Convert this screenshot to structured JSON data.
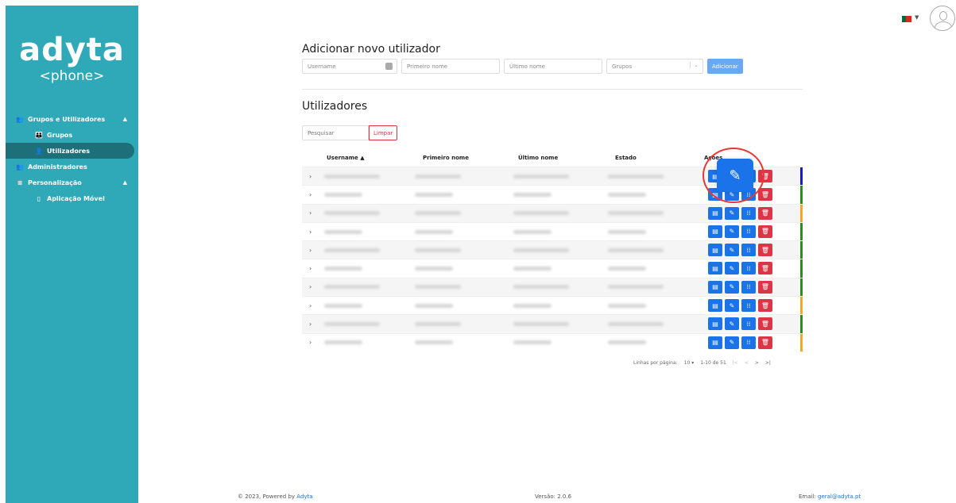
{
  "brand": {
    "name": "adyta",
    "sub": "<phone>"
  },
  "sidebar": {
    "items": [
      {
        "label": "Grupos e Utilizadores",
        "icon": "users-icon",
        "glyph": "👥",
        "caret": "▲"
      },
      {
        "label": "Grupos",
        "icon": "group-icon",
        "glyph": "👪"
      },
      {
        "label": "Utilizadores",
        "icon": "user-icon",
        "glyph": "👤"
      },
      {
        "label": "Administradores",
        "icon": "admin-icon",
        "glyph": "👥"
      },
      {
        "label": "Personalização",
        "icon": "menu-icon",
        "glyph": "≡",
        "caret": "▲"
      },
      {
        "label": "Aplicação Móvel",
        "icon": "mobile-icon",
        "glyph": "▯"
      }
    ]
  },
  "add_user": {
    "title": "Adicionar novo utilizador",
    "username_placeholder": "Username",
    "first_name_placeholder": "Primeiro nome",
    "last_name_placeholder": "Último nome",
    "groups_placeholder": "Grupos",
    "add_label": "Adicionar"
  },
  "users": {
    "title": "Utilizadores",
    "search_placeholder": "Pesquisar",
    "clear_label": "Limpar",
    "columns": [
      "Username ▲",
      "Primeiro nome",
      "Último nome",
      "Estado",
      "Ações"
    ],
    "rows": 10,
    "status_colors": [
      "#1a1acc",
      "#2e8b1f",
      "#f5a623",
      "#2e8b1f",
      "#2e8b1f",
      "#2e8b1f",
      "#2e8b1f",
      "#f5a623",
      "#2e8b1f",
      "#f5a623"
    ],
    "row_action_glyphs": [
      "▤",
      "✎",
      "⁞⁞",
      "🗑"
    ]
  },
  "pager": {
    "rows_label": "Linhas por página:",
    "rows_value": "10",
    "range": "1-10 de 51",
    "first": "|<",
    "prev": "<",
    "next": ">",
    "last": ">|"
  },
  "zoom_edit_glyph": "✎",
  "footer": {
    "copyright": "© 2023, Powered by ",
    "powered_link": "Adyta",
    "version": "Versão: 2.0.6",
    "email_label": "Email: ",
    "email": "geral@adyta.pt"
  }
}
